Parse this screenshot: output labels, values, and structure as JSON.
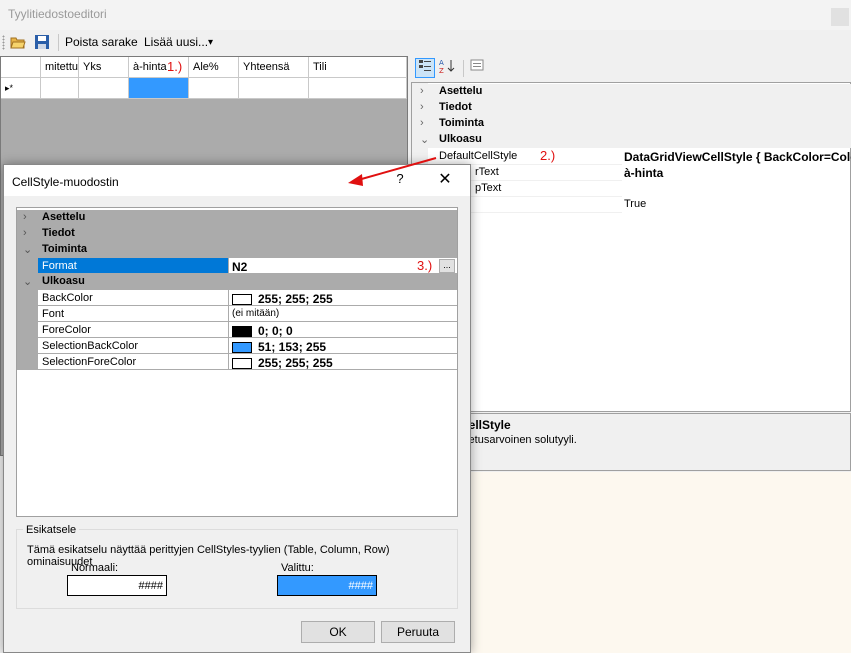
{
  "main_window": {
    "title": "Tyylitiedostoeditori"
  },
  "toolbar": {
    "remove_column": "Poista sarake",
    "add_new": "Lisää uusi...",
    "dropdown_arrow": "▾"
  },
  "grid": {
    "columns": [
      "",
      "mitettu",
      "Yks",
      "à-hinta",
      "Ale%",
      "Yhteensä",
      "Tili"
    ],
    "new_row_marker": "▸*",
    "annotation": "1.)"
  },
  "property_grid": {
    "sort_icons": [
      "categorized-icon",
      "alphabetical-icon",
      "property-pages-icon"
    ],
    "categories": {
      "asettelu": "Asettelu",
      "tiedot": "Tiedot",
      "toiminta": "Toiminta",
      "ulkoasu": "Ulkoasu"
    },
    "properties": [
      {
        "name": "DefaultCellStyle",
        "value": "DataGridViewCellStyle { BackColor=Colo",
        "annotation": "2.)"
      },
      {
        "name": "rText",
        "value": "à-hinta"
      },
      {
        "name": "pText",
        "value": ""
      },
      {
        "name": "",
        "value": "True"
      }
    ],
    "description_title": "CellStyle",
    "description_text": "oletusarvoinen solutyyli."
  },
  "dialog": {
    "title": "CellStyle-muodostin",
    "help": "?",
    "close": "✕",
    "categories": {
      "asettelu": "Asettelu",
      "tiedot": "Tiedot",
      "toiminta": "Toiminta",
      "ulkoasu": "Ulkoasu"
    },
    "format": {
      "name": "Format",
      "value": "N2",
      "annotation": "3.)",
      "ellipsis": "..."
    },
    "appearance": [
      {
        "name": "BackColor",
        "value": "255; 255; 255",
        "color": "#ffffff"
      },
      {
        "name": "Font",
        "value": "(ei mitään)",
        "color": ""
      },
      {
        "name": "ForeColor",
        "value": "0; 0; 0",
        "color": "#000000"
      },
      {
        "name": "SelectionBackColor",
        "value": "51; 153; 255",
        "color": "#3399ff"
      },
      {
        "name": "SelectionForeColor",
        "value": "255; 255; 255",
        "color": "#ffffff"
      }
    ],
    "preview": {
      "legend": "Esikatsele",
      "description": "Tämä esikatselu näyttää perittyjen CellStyles-tyylien (Table, Column, Row) ominaisuudet",
      "normal_label": "Normaali:",
      "normal_value": "####",
      "selected_label": "Valittu:",
      "selected_value": "####"
    },
    "ok": "OK",
    "cancel": "Peruuta"
  },
  "colors": {
    "selection": "#3399ff",
    "highlight": "#0078d7",
    "annotation": "#e01010"
  }
}
